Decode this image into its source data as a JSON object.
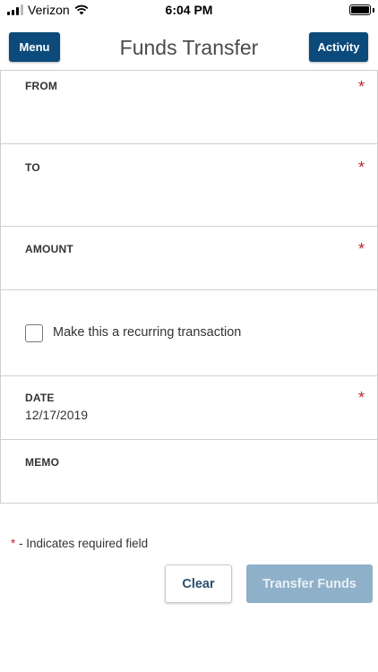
{
  "status_bar": {
    "carrier": "Verizon",
    "time": "6:04 PM",
    "icons": [
      "signal-icon",
      "wifi-icon",
      "battery-icon"
    ]
  },
  "header": {
    "menu_label": "Menu",
    "title": "Funds Transfer",
    "activity_label": "Activity"
  },
  "form": {
    "from": {
      "label": "FROM",
      "required_mark": "*"
    },
    "to": {
      "label": "TO",
      "required_mark": "*"
    },
    "amount": {
      "label": "AMOUNT",
      "required_mark": "*"
    },
    "recurring": {
      "label": "Make this a recurring transaction",
      "checked": false
    },
    "date": {
      "label": "DATE",
      "value": "12/17/2019",
      "required_mark": "*"
    },
    "memo": {
      "label": "MEMO"
    }
  },
  "footnote": {
    "star": "*",
    "text": " - Indicates required field"
  },
  "actions": {
    "clear_label": "Clear",
    "transfer_label": "Transfer Funds"
  },
  "colors": {
    "primary": "#0b4a7a",
    "required": "#c0272d",
    "disabled_button": "#8fb0c9"
  }
}
